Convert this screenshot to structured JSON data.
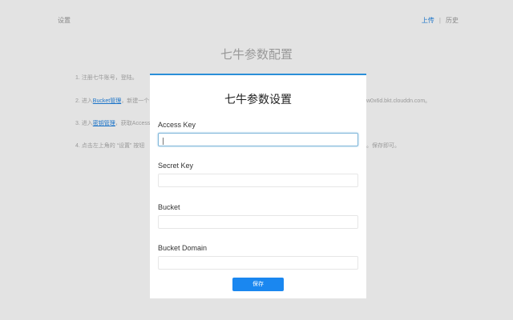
{
  "header": {
    "settings_link": "设置",
    "nav_upload": "上传",
    "nav_separator": "|",
    "nav_history": "历史"
  },
  "background": {
    "title": "七牛参数配置",
    "step1": "1. 注册七牛账号，登陆。",
    "step2_prefix": "2. 进入",
    "step2_link": "Bucket管理",
    "step2_suffix": "，新建一个",
    "step2_tail": "w0x6d.bkt.clouddn.com。",
    "step3_prefix": "3. 进入",
    "step3_link": "密钥管理",
    "step3_suffix": "，获取Access",
    "step4_prefix": "4. 点击左上角的 “设置” 按钮",
    "step4_tail": "。保存即可。"
  },
  "modal": {
    "title": "七牛参数设置",
    "fields": [
      {
        "label": "Access Key",
        "value": "",
        "placeholder": ""
      },
      {
        "label": "Secret Key",
        "value": "",
        "placeholder": ""
      },
      {
        "label": "Bucket",
        "value": "",
        "placeholder": ""
      },
      {
        "label": "Bucket Domain",
        "value": "",
        "placeholder": ""
      }
    ],
    "save_label": "保存"
  },
  "colors": {
    "accent": "#1a87f0",
    "modal_border": "#2a8fd8",
    "link": "#1a73c8",
    "backdrop": "#e3e3e3"
  }
}
